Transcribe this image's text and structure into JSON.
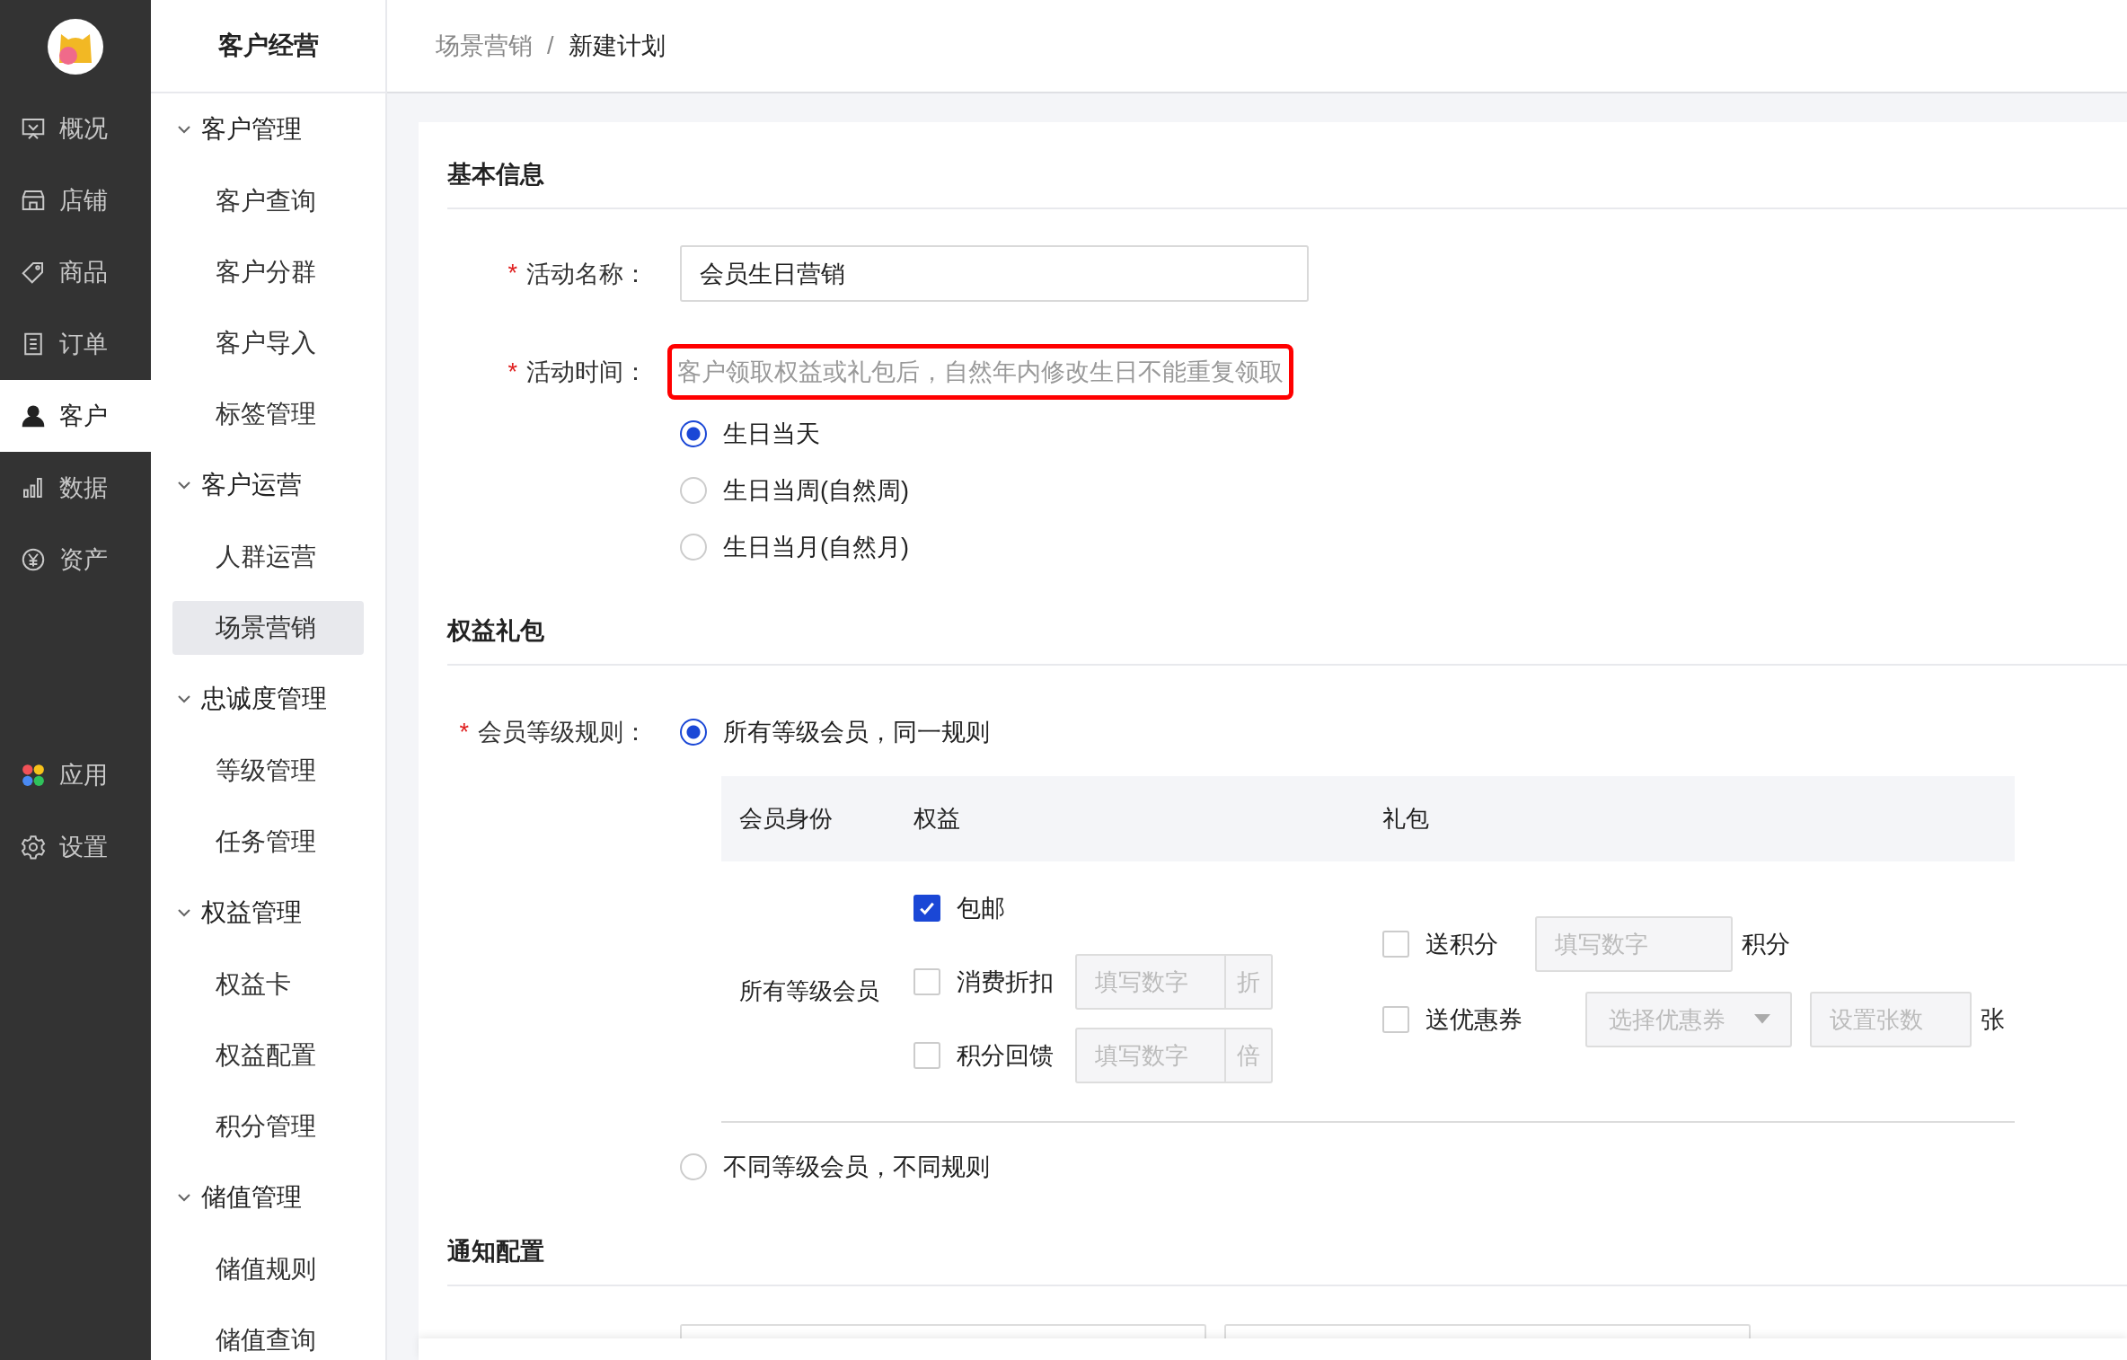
{
  "rail": {
    "items": [
      {
        "label": "概况",
        "selected": false
      },
      {
        "label": "店铺",
        "selected": false
      },
      {
        "label": "商品",
        "selected": false
      },
      {
        "label": "订单",
        "selected": false
      },
      {
        "label": "客户",
        "selected": true
      },
      {
        "label": "数据",
        "selected": false
      },
      {
        "label": "资产",
        "selected": false
      }
    ],
    "bottom_items": [
      {
        "label": "应用",
        "selected": false
      },
      {
        "label": "设置",
        "selected": false
      }
    ]
  },
  "menu": {
    "title": "客户经营",
    "groups": [
      {
        "label": "客户管理",
        "expanded": true,
        "children": [
          {
            "label": "客户查询",
            "selected": false
          },
          {
            "label": "客户分群",
            "selected": false
          },
          {
            "label": "客户导入",
            "selected": false
          },
          {
            "label": "标签管理",
            "selected": false
          }
        ]
      },
      {
        "label": "客户运营",
        "expanded": true,
        "children": [
          {
            "label": "人群运营",
            "selected": false
          },
          {
            "label": "场景营销",
            "selected": true
          }
        ]
      },
      {
        "label": "忠诚度管理",
        "expanded": true,
        "children": [
          {
            "label": "等级管理",
            "selected": false
          },
          {
            "label": "任务管理",
            "selected": false
          }
        ]
      },
      {
        "label": "权益管理",
        "expanded": true,
        "children": [
          {
            "label": "权益卡",
            "selected": false
          },
          {
            "label": "权益配置",
            "selected": false
          },
          {
            "label": "积分管理",
            "selected": false
          }
        ]
      },
      {
        "label": "储值管理",
        "expanded": true,
        "children": [
          {
            "label": "储值规则",
            "selected": false
          },
          {
            "label": "储值查询",
            "selected": false
          }
        ]
      }
    ]
  },
  "breadcrumb": {
    "items": [
      "场景营销",
      "新建计划"
    ],
    "separator": "/"
  },
  "basic": {
    "title": "基本信息",
    "name_field": {
      "label": "活动名称：",
      "required_mark": "*",
      "value": "会员生日营销"
    },
    "time_field": {
      "label": "活动时间：",
      "required_mark": "*",
      "hint": "客户领取权益或礼包后，自然年内修改生日不能重复领取",
      "highlighted": true,
      "options": [
        {
          "label": "生日当天",
          "selected": true
        },
        {
          "label": "生日当周(自然周)",
          "selected": false
        },
        {
          "label": "生日当月(自然月)",
          "selected": false
        }
      ]
    }
  },
  "benefits": {
    "title": "权益礼包",
    "rule_label": "会员等级规则：",
    "required_mark": "*",
    "rules": [
      {
        "label": "所有等级会员，同一规则",
        "selected": true
      },
      {
        "label": "不同等级会员，不同规则",
        "selected": false
      }
    ],
    "table": {
      "columns": [
        "会员身份",
        "权益",
        "礼包"
      ],
      "rows": [
        {
          "member": "所有等级会员",
          "benefits": [
            {
              "label": "包邮",
              "checked": true
            },
            {
              "label": "消费折扣",
              "checked": false,
              "placeholder": "填写数字",
              "unit": "折"
            },
            {
              "label": "积分回馈",
              "checked": false,
              "placeholder": "填写数字",
              "unit": "倍"
            }
          ],
          "gifts": [
            {
              "kind": "points",
              "label": "送积分",
              "checked": false,
              "placeholder": "填写数字",
              "suffix": "积分"
            },
            {
              "kind": "coupon",
              "label": "送优惠券",
              "checked": false,
              "select_placeholder": "选择优惠券",
              "placeholder": "设置张数",
              "suffix": "张"
            }
          ]
        }
      ]
    }
  },
  "notify": {
    "title": "通知配置"
  }
}
